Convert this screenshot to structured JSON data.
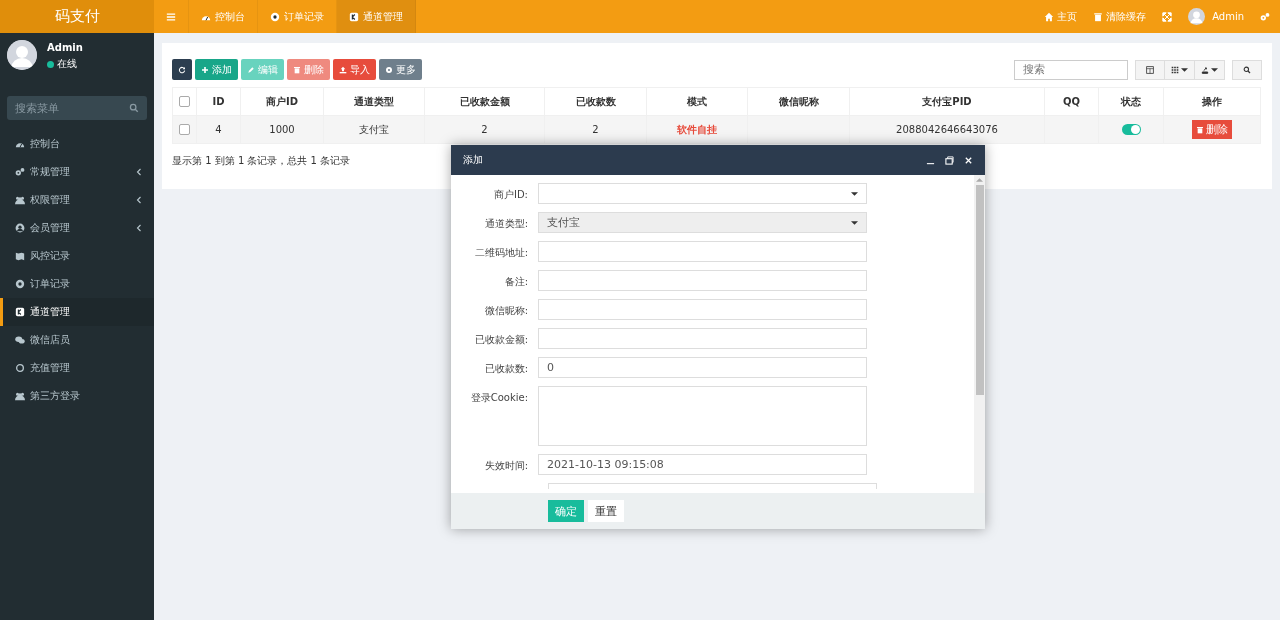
{
  "brand": "码支付",
  "top_tabs": [
    {
      "label": "控制台",
      "selected": false
    },
    {
      "label": "订单记录",
      "selected": false
    },
    {
      "label": "通道管理",
      "selected": true
    }
  ],
  "top_right": {
    "home": "主页",
    "clear_cache": "清除缓存",
    "user": "Admin"
  },
  "sidebar": {
    "user": {
      "name": "Admin",
      "status": "在线"
    },
    "search": {
      "placeholder": "搜索菜单"
    },
    "items": [
      {
        "label": "控制台",
        "expandable": false,
        "selected": false
      },
      {
        "label": "常规管理",
        "expandable": true,
        "selected": false
      },
      {
        "label": "权限管理",
        "expandable": true,
        "selected": false
      },
      {
        "label": "会员管理",
        "expandable": true,
        "selected": false
      },
      {
        "label": "风控记录",
        "expandable": false,
        "selected": false
      },
      {
        "label": "订单记录",
        "expandable": false,
        "selected": false
      },
      {
        "label": "通道管理",
        "expandable": false,
        "selected": true
      },
      {
        "label": "微信店员",
        "expandable": false,
        "selected": false
      },
      {
        "label": "充值管理",
        "expandable": false,
        "selected": false
      },
      {
        "label": "第三方登录",
        "expandable": false,
        "selected": false
      }
    ]
  },
  "toolbar": [
    {
      "kind": "refresh",
      "disabled": false
    },
    {
      "kind": "add",
      "label": "添加",
      "disabled": false
    },
    {
      "kind": "edit",
      "label": "编辑",
      "disabled": true
    },
    {
      "kind": "delete",
      "label": "删除",
      "disabled": true
    },
    {
      "kind": "import",
      "label": "导入",
      "disabled": false
    },
    {
      "kind": "more",
      "label": "更多",
      "disabled": false
    }
  ],
  "table_search": {
    "placeholder": "搜索"
  },
  "table": {
    "all_checked": false,
    "columns": [
      "ID",
      "商户ID",
      "通道类型",
      "已收款金额",
      "已收款数",
      "模式",
      "微信昵称",
      "支付宝PID",
      "QQ",
      "状态",
      "操作"
    ],
    "rows": [
      {
        "checked": false,
        "cells": [
          "4",
          "1000",
          "支付宝",
          "2",
          "2",
          "软件自挂",
          "",
          "2088042646643076",
          ""
        ],
        "status_on": true,
        "action": "删除"
      }
    ]
  },
  "pagination_info": "显示第 1 到第 1 条记录，总共 1 条记录",
  "modal": {
    "title": "添加",
    "fields": [
      {
        "kind": "select",
        "label": "商户ID:",
        "disabled": false
      },
      {
        "kind": "select",
        "label": "通道类型:",
        "value": "支付宝",
        "disabled": true
      },
      {
        "kind": "input",
        "label": "二维码地址:",
        "disabled": false
      },
      {
        "kind": "input",
        "label": "备注:",
        "disabled": false
      },
      {
        "kind": "input",
        "label": "微信昵称:",
        "disabled": false
      },
      {
        "kind": "input",
        "label": "已收款金额:",
        "disabled": false
      },
      {
        "kind": "input",
        "label": "已收款数:",
        "value": "0",
        "disabled": false
      },
      {
        "kind": "textarea",
        "label": "登录Cookie:",
        "disabled": false
      },
      {
        "kind": "input",
        "label": "失效时间:",
        "value": "2021-10-13 09:15:08",
        "disabled": false
      },
      {
        "kind": "partial"
      }
    ],
    "buttons": [
      {
        "kind": "primary",
        "label": "确定"
      },
      {
        "kind": "default",
        "label": "重置"
      }
    ]
  }
}
